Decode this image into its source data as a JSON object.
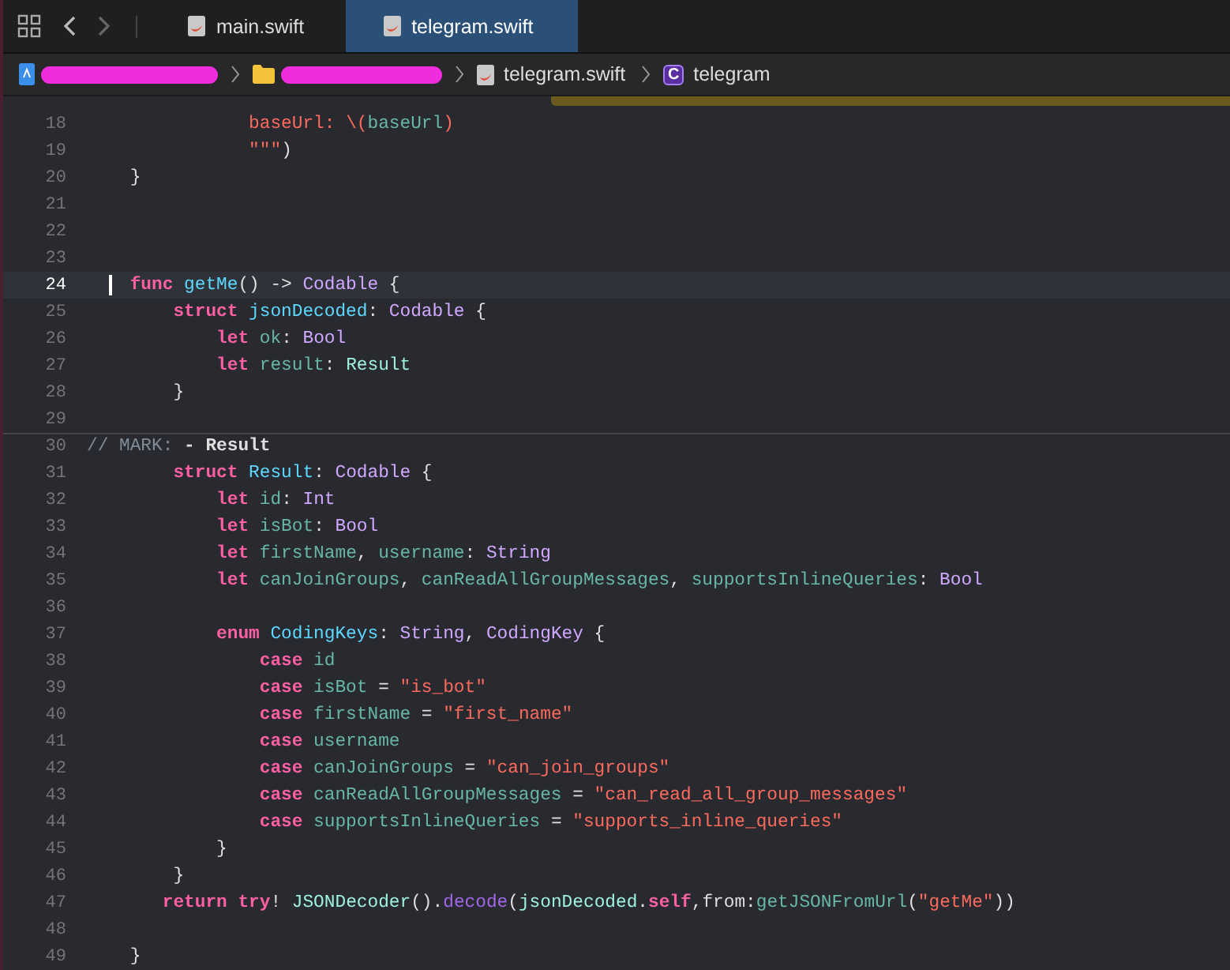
{
  "tabs": [
    {
      "label": "main.swift",
      "selected": false
    },
    {
      "label": "telegram.swift",
      "selected": true
    }
  ],
  "breadcrumb": {
    "file": "telegram.swift",
    "symbol_badge": "C",
    "symbol": "telegram"
  },
  "editor": {
    "lines": [
      {
        "no": "18",
        "current": false,
        "tokens": [
          {
            "kind": "string",
            "text": "               baseUrl: \\("
          },
          {
            "kind": "property",
            "text": "baseUrl"
          },
          {
            "kind": "string",
            "text": ")"
          }
        ]
      },
      {
        "no": "19",
        "current": false,
        "tokens": [
          {
            "kind": "string",
            "text": "               \"\"\""
          },
          {
            "kind": "plain",
            "text": ")"
          }
        ]
      },
      {
        "no": "20",
        "current": false,
        "tokens": [
          {
            "kind": "plain",
            "text": "    }"
          }
        ]
      },
      {
        "no": "21",
        "current": false
      },
      {
        "no": "22",
        "current": false
      },
      {
        "no": "23",
        "current": false
      },
      {
        "no": "24",
        "current": true,
        "tokens": [
          {
            "kind": "keyword",
            "text": "    func"
          },
          {
            "kind": "declaration",
            "text": " getMe"
          },
          {
            "kind": "plain",
            "text": "() -> "
          },
          {
            "kind": "type",
            "text": "Codable"
          },
          {
            "kind": "plain",
            "text": " {"
          }
        ]
      },
      {
        "no": "25",
        "current": false,
        "tokens": [
          {
            "kind": "keyword",
            "text": "        struct"
          },
          {
            "kind": "declaration",
            "text": " jsonDecoded"
          },
          {
            "kind": "plain",
            "text": ": "
          },
          {
            "kind": "type",
            "text": "Codable"
          },
          {
            "kind": "plain",
            "text": " {"
          }
        ]
      },
      {
        "no": "26",
        "current": false,
        "tokens": [
          {
            "kind": "keyword",
            "text": "            let"
          },
          {
            "kind": "property",
            "text": " ok"
          },
          {
            "kind": "plain",
            "text": ": "
          },
          {
            "kind": "type",
            "text": "Bool"
          }
        ]
      },
      {
        "no": "27",
        "current": false,
        "tokens": [
          {
            "kind": "keyword",
            "text": "            let"
          },
          {
            "kind": "property",
            "text": " result"
          },
          {
            "kind": "plain",
            "text": ": "
          },
          {
            "kind": "project_type",
            "text": "Result"
          }
        ]
      },
      {
        "no": "28",
        "current": false,
        "tokens": [
          {
            "kind": "plain",
            "text": "        }"
          }
        ]
      },
      {
        "no": "29",
        "current": false
      },
      {
        "no": "30",
        "current": false,
        "tokens": [
          {
            "kind": "comment",
            "text": "// MARK: "
          },
          {
            "kind": "mark",
            "text": "- Result"
          }
        ]
      },
      {
        "no": "31",
        "current": false,
        "tokens": [
          {
            "kind": "keyword",
            "text": "        struct"
          },
          {
            "kind": "declaration",
            "text": " Result"
          },
          {
            "kind": "plain",
            "text": ": "
          },
          {
            "kind": "type",
            "text": "Codable"
          },
          {
            "kind": "plain",
            "text": " {"
          }
        ]
      },
      {
        "no": "32",
        "current": false,
        "tokens": [
          {
            "kind": "keyword",
            "text": "            let"
          },
          {
            "kind": "property",
            "text": " id"
          },
          {
            "kind": "plain",
            "text": ": "
          },
          {
            "kind": "type",
            "text": "Int"
          }
        ]
      },
      {
        "no": "33",
        "current": false,
        "tokens": [
          {
            "kind": "keyword",
            "text": "            let"
          },
          {
            "kind": "property",
            "text": " isBot"
          },
          {
            "kind": "plain",
            "text": ": "
          },
          {
            "kind": "type",
            "text": "Bool"
          }
        ]
      },
      {
        "no": "34",
        "current": false,
        "tokens": [
          {
            "kind": "keyword",
            "text": "            let"
          },
          {
            "kind": "property",
            "text": " firstName"
          },
          {
            "kind": "plain",
            "text": ", "
          },
          {
            "kind": "property",
            "text": "username"
          },
          {
            "kind": "plain",
            "text": ": "
          },
          {
            "kind": "type",
            "text": "String"
          }
        ]
      },
      {
        "no": "35",
        "current": false,
        "tokens": [
          {
            "kind": "keyword",
            "text": "            let"
          },
          {
            "kind": "property",
            "text": " canJoinGroups"
          },
          {
            "kind": "plain",
            "text": ", "
          },
          {
            "kind": "property",
            "text": "canReadAllGroupMessages"
          },
          {
            "kind": "plain",
            "text": ", "
          },
          {
            "kind": "property",
            "text": "supportsInlineQueries"
          },
          {
            "kind": "plain",
            "text": ": "
          },
          {
            "kind": "type",
            "text": "Bool"
          }
        ]
      },
      {
        "no": "36",
        "current": false
      },
      {
        "no": "37",
        "current": false,
        "tokens": [
          {
            "kind": "keyword",
            "text": "            enum"
          },
          {
            "kind": "declaration",
            "text": " CodingKeys"
          },
          {
            "kind": "plain",
            "text": ": "
          },
          {
            "kind": "type",
            "text": "String"
          },
          {
            "kind": "plain",
            "text": ", "
          },
          {
            "kind": "type",
            "text": "CodingKey"
          },
          {
            "kind": "plain",
            "text": " {"
          }
        ]
      },
      {
        "no": "38",
        "current": false,
        "tokens": [
          {
            "kind": "keyword",
            "text": "                case"
          },
          {
            "kind": "property",
            "text": " id"
          }
        ]
      },
      {
        "no": "39",
        "current": false,
        "tokens": [
          {
            "kind": "keyword",
            "text": "                case"
          },
          {
            "kind": "property",
            "text": " isBot"
          },
          {
            "kind": "plain",
            "text": " = "
          },
          {
            "kind": "string",
            "text": "\"is_bot\""
          }
        ]
      },
      {
        "no": "40",
        "current": false,
        "tokens": [
          {
            "kind": "keyword",
            "text": "                case"
          },
          {
            "kind": "property",
            "text": " firstName"
          },
          {
            "kind": "plain",
            "text": " = "
          },
          {
            "kind": "string",
            "text": "\"first_name\""
          }
        ]
      },
      {
        "no": "41",
        "current": false,
        "tokens": [
          {
            "kind": "keyword",
            "text": "                case"
          },
          {
            "kind": "property",
            "text": " username"
          }
        ]
      },
      {
        "no": "42",
        "current": false,
        "tokens": [
          {
            "kind": "keyword",
            "text": "                case"
          },
          {
            "kind": "property",
            "text": " canJoinGroups"
          },
          {
            "kind": "plain",
            "text": " = "
          },
          {
            "kind": "string",
            "text": "\"can_join_groups\""
          }
        ]
      },
      {
        "no": "43",
        "current": false,
        "tokens": [
          {
            "kind": "keyword",
            "text": "                case"
          },
          {
            "kind": "property",
            "text": " canReadAllGroupMessages"
          },
          {
            "kind": "plain",
            "text": " = "
          },
          {
            "kind": "string",
            "text": "\"can_read_all_group_messages\""
          }
        ]
      },
      {
        "no": "44",
        "current": false,
        "tokens": [
          {
            "kind": "keyword",
            "text": "                case"
          },
          {
            "kind": "property",
            "text": " supportsInlineQueries"
          },
          {
            "kind": "plain",
            "text": " = "
          },
          {
            "kind": "string",
            "text": "\"supports_inline_queries\""
          }
        ]
      },
      {
        "no": "45",
        "current": false,
        "tokens": [
          {
            "kind": "plain",
            "text": "            }"
          }
        ]
      },
      {
        "no": "46",
        "current": false,
        "tokens": [
          {
            "kind": "plain",
            "text": "        }"
          }
        ]
      },
      {
        "no": "47",
        "current": false,
        "tokens": [
          {
            "kind": "keyword",
            "text": "       return"
          },
          {
            "kind": "keyword",
            "text": " try"
          },
          {
            "kind": "plain",
            "text": "! "
          },
          {
            "kind": "project_type",
            "text": "JSONDecoder"
          },
          {
            "kind": "plain",
            "text": "()."
          },
          {
            "kind": "function",
            "text": "decode"
          },
          {
            "kind": "plain",
            "text": "("
          },
          {
            "kind": "project_type",
            "text": "jsonDecoded"
          },
          {
            "kind": "plain",
            "text": "."
          },
          {
            "kind": "keyword",
            "text": "self"
          },
          {
            "kind": "plain",
            "text": ",from:"
          },
          {
            "kind": "project_function",
            "text": "getJSONFromUrl"
          },
          {
            "kind": "plain",
            "text": "("
          },
          {
            "kind": "string",
            "text": "\"getMe\""
          },
          {
            "kind": "plain",
            "text": "))"
          }
        ]
      },
      {
        "no": "48",
        "current": false
      },
      {
        "no": "49",
        "current": false,
        "tokens": [
          {
            "kind": "plain",
            "text": "    }"
          }
        ]
      }
    ]
  }
}
